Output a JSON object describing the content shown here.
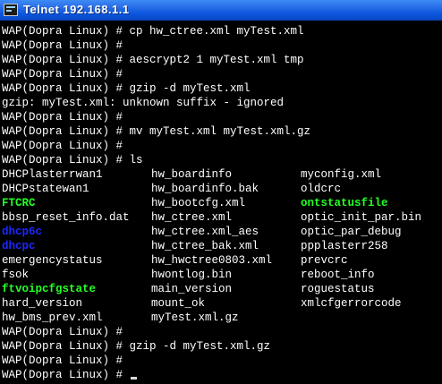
{
  "window": {
    "title": "Telnet 192.168.1.1"
  },
  "terminal": {
    "lines_before": [
      "WAP(Dopra Linux) # cp hw_ctree.xml myTest.xml",
      "WAP(Dopra Linux) #",
      "WAP(Dopra Linux) # aescrypt2 1 myTest.xml tmp",
      "WAP(Dopra Linux) #",
      "WAP(Dopra Linux) # gzip -d myTest.xml",
      "gzip: myTest.xml: unknown suffix - ignored",
      "WAP(Dopra Linux) #",
      "WAP(Dopra Linux) # mv myTest.xml myTest.xml.gz",
      "WAP(Dopra Linux) #",
      "WAP(Dopra Linux) # ls"
    ],
    "listing": [
      [
        "DHCPlasterrwan1",
        "hw_boardinfo",
        "myconfig.xml"
      ],
      [
        "DHCPstatewan1",
        "hw_boardinfo.bak",
        "oldcrc"
      ],
      [
        "FTCRC",
        "hw_bootcfg.xml",
        "ontstatusfile"
      ],
      [
        "bbsp_reset_info.dat",
        "hw_ctree.xml",
        "optic_init_par.bin"
      ],
      [
        "dhcp6c",
        "hw_ctree.xml_aes",
        "optic_par_debug"
      ],
      [
        "dhcpc",
        "hw_ctree_bak.xml",
        "ppplasterr258"
      ],
      [
        "emergencystatus",
        "hw_hwctree0803.xml",
        "prevcrc"
      ],
      [
        "fsok",
        "hwontlog.bin",
        "reboot_info"
      ],
      [
        "ftvoipcfgstate",
        "main_version",
        "roguestatus"
      ],
      [
        "hard_version",
        "mount_ok",
        "xmlcfgerrorcode"
      ],
      [
        "hw_bms_prev.xml",
        "myTest.xml.gz",
        ""
      ]
    ],
    "listing_colors": [
      [
        "white",
        "white",
        "white"
      ],
      [
        "white",
        "white",
        "white"
      ],
      [
        "green",
        "white",
        "green"
      ],
      [
        "white",
        "white",
        "white"
      ],
      [
        "blue",
        "white",
        "white"
      ],
      [
        "blue",
        "white",
        "white"
      ],
      [
        "white",
        "white",
        "white"
      ],
      [
        "white",
        "white",
        "white"
      ],
      [
        "green",
        "white",
        "white"
      ],
      [
        "white",
        "white",
        "white"
      ],
      [
        "white",
        "white",
        "white"
      ]
    ],
    "lines_after": [
      "WAP(Dopra Linux) #",
      "WAP(Dopra Linux) # gzip -d myTest.xml.gz",
      "WAP(Dopra Linux) #",
      "WAP(Dopra Linux) #"
    ]
  },
  "colors": {
    "background": "#000000",
    "text": "#ffffff",
    "executable": "#22ff22",
    "directory": "#1a28ff",
    "titlebar": "#0b55dd"
  }
}
